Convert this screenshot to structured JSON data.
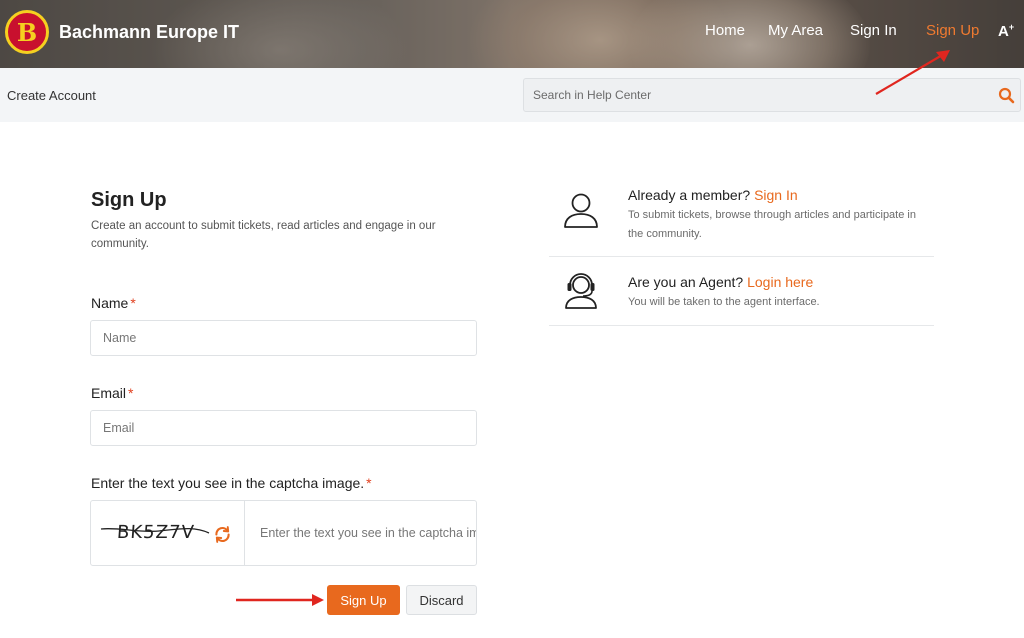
{
  "header": {
    "logo_letter": "B",
    "brand": "Bachmann Europe IT",
    "nav": {
      "home": "Home",
      "my_area": "My Area",
      "sign_in": "Sign In",
      "sign_up": "Sign Up"
    },
    "font_size_label": "A",
    "font_size_sup": "+"
  },
  "subbar": {
    "breadcrumb": "Create Account",
    "search_placeholder": "Search in Help Center"
  },
  "form": {
    "title": "Sign Up",
    "description": "Create an account to submit tickets, read articles and engage in our community.",
    "name_label": "Name",
    "name_placeholder": "Name",
    "email_label": "Email",
    "email_placeholder": "Email",
    "captcha_label": "Enter the text you see in the captcha image.",
    "captcha_text": "BK5Z7V",
    "captcha_placeholder": "Enter the text you see in the captcha image",
    "required_mark": "*",
    "submit_label": "Sign Up",
    "discard_label": "Discard"
  },
  "side": {
    "member_title": "Already a member?",
    "member_link": "Sign In",
    "member_sub": "To submit tickets, browse through articles and participate in the community.",
    "agent_title": "Are you an Agent?",
    "agent_link": "Login here",
    "agent_sub": "You will be taken to the agent interface."
  },
  "colors": {
    "accent": "#e8691e",
    "brand_red": "#c8102e",
    "brand_yellow": "#f5d020",
    "annotation_red": "#e0261f"
  }
}
